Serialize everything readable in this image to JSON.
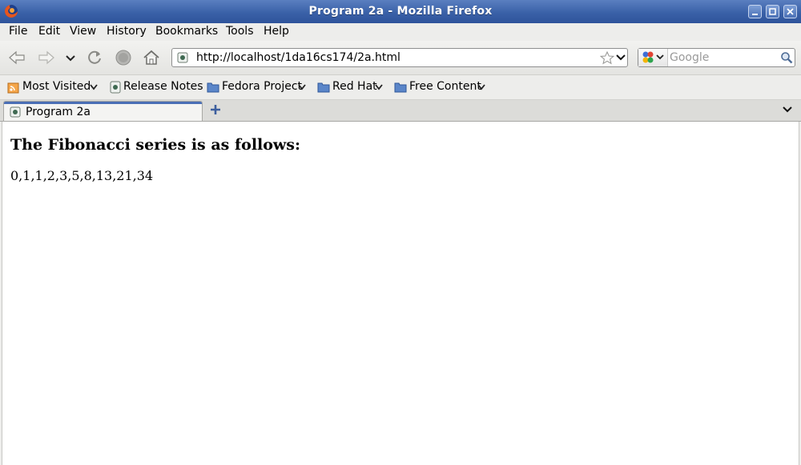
{
  "window": {
    "title": "Program 2a - Mozilla Firefox",
    "controls": [
      "minimize-icon",
      "maximize-icon",
      "close-icon"
    ]
  },
  "menubar": {
    "items": [
      {
        "label": "File"
      },
      {
        "label": "Edit"
      },
      {
        "label": "View"
      },
      {
        "label": "History"
      },
      {
        "label": "Bookmarks"
      },
      {
        "label": "Tools"
      },
      {
        "label": "Help"
      }
    ]
  },
  "navbar": {
    "url": "http://localhost/1da16cs174/2a.html",
    "search_placeholder": "Google",
    "buttons": [
      "back-icon",
      "forward-icon",
      "history-dropdown-icon",
      "reload-icon",
      "stop-icon",
      "home-icon"
    ]
  },
  "bookmarks": {
    "items": [
      {
        "label": "Most Visited",
        "icon": "rss-icon",
        "dropdown": true
      },
      {
        "label": "Release Notes",
        "icon": "page-icon",
        "dropdown": false
      },
      {
        "label": "Fedora Project",
        "icon": "folder-icon",
        "dropdown": true
      },
      {
        "label": "Red Hat",
        "icon": "folder-icon",
        "dropdown": true
      },
      {
        "label": "Free Content",
        "icon": "folder-icon",
        "dropdown": true
      }
    ]
  },
  "tabs": [
    {
      "label": "Program 2a",
      "active": true
    }
  ],
  "page": {
    "heading": "The Fibonacci series is as follows:",
    "series": "0,1,1,2,3,5,8,13,21,34"
  },
  "colors": {
    "titlebar": "#3a61a8",
    "chrome": "#ededeb",
    "tab_accent": "#4a6fb5",
    "folder": "#5b86c9"
  }
}
